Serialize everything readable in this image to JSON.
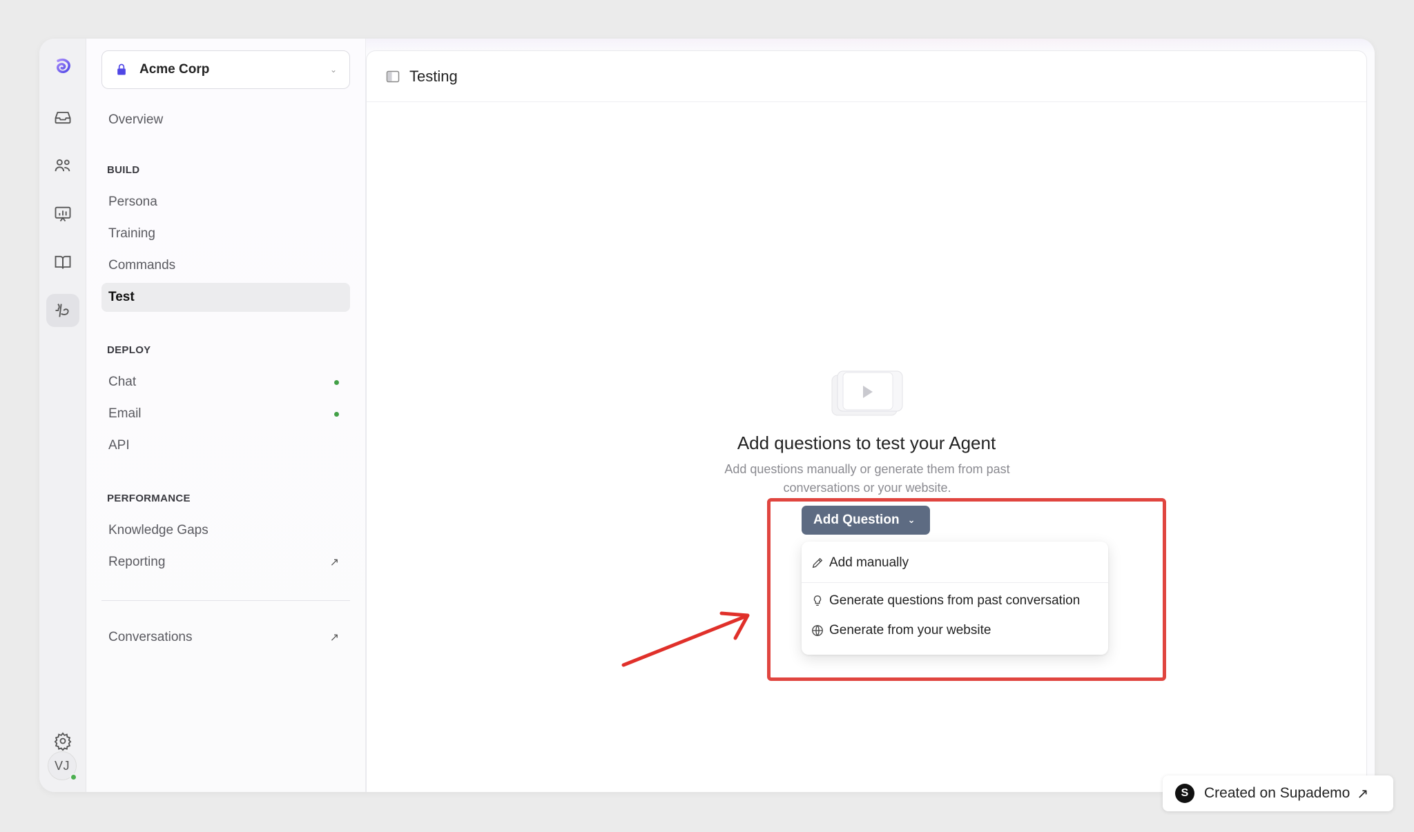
{
  "workspace": {
    "name": "Acme Corp"
  },
  "sidebar": {
    "overview": "Overview",
    "sections": {
      "build": "BUILD",
      "deploy": "DEPLOY",
      "performance": "PERFORMANCE"
    },
    "build_items": [
      "Persona",
      "Training",
      "Commands",
      "Test"
    ],
    "deploy_items": [
      "Chat",
      "Email",
      "API"
    ],
    "performance_items": [
      "Knowledge Gaps",
      "Reporting"
    ],
    "conversations": "Conversations",
    "active_item": "Test"
  },
  "rail": {
    "icons": [
      "logo-icon",
      "inbox-icon",
      "users-icon",
      "presentation-chart-icon",
      "book-icon",
      "agent-icon",
      "gear-icon"
    ],
    "avatar_initials": "VJ"
  },
  "main": {
    "title": "Testing",
    "empty_title": "Add questions to test your Agent",
    "empty_subtitle": "Add questions manually or generate them from past conversations or your website.",
    "add_button": "Add Question",
    "menu": [
      "Add manually",
      "Generate questions from past conversation",
      "Generate from your website"
    ]
  },
  "badge": {
    "letter": "S",
    "text": "Created on Supademo"
  },
  "colors": {
    "accent": "#5d6b82",
    "highlight": "#e0453f",
    "status_green": "#43a047",
    "brand": "#4f46e5"
  }
}
